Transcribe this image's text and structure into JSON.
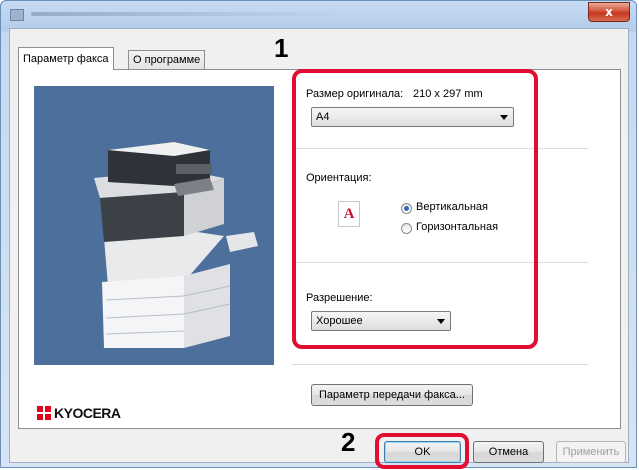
{
  "window": {
    "close_label": "x"
  },
  "tabs": [
    {
      "label": "Параметр факса"
    },
    {
      "label": "О программе"
    }
  ],
  "brand": {
    "logo_text": "KYOCERA",
    "logo_color": "#e2001a"
  },
  "original_size": {
    "label": "Размер оригинала:",
    "value_text": "210 x 297 mm",
    "selected": "A4"
  },
  "orientation": {
    "label": "Ориентация:",
    "icon_letter": "A",
    "options": [
      {
        "label": "Вертикальная",
        "checked": true
      },
      {
        "label": "Горизонтальная",
        "checked": false
      }
    ]
  },
  "resolution": {
    "label": "Разрешение:",
    "selected": "Хорошее"
  },
  "fax_transmission_button": "Параметр передачи факса...",
  "footer": {
    "ok": "OK",
    "cancel": "Отмена",
    "apply": "Применить"
  },
  "annotations": {
    "callout_1": "1",
    "callout_2": "2",
    "color": "#e10e32"
  }
}
